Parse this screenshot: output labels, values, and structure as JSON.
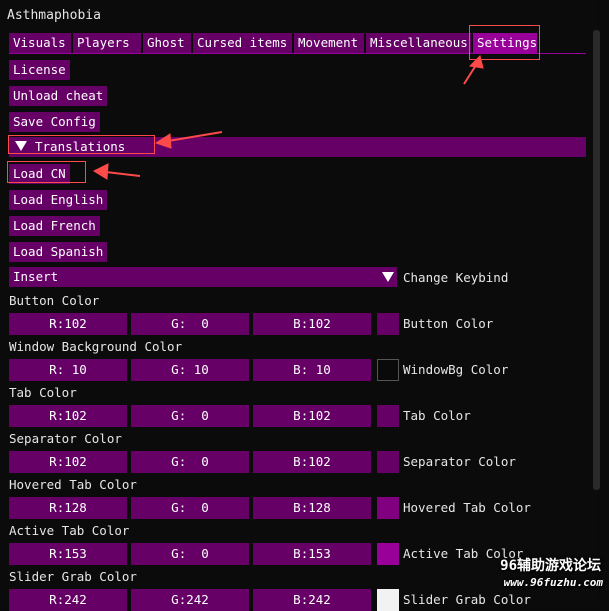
{
  "window": {
    "title": "Asthmaphobia"
  },
  "tabs": [
    {
      "label": "Visuals"
    },
    {
      "label": "Players"
    },
    {
      "label": "Ghost"
    },
    {
      "label": "Cursed items"
    },
    {
      "label": "Movement"
    },
    {
      "label": "Miscellaneous"
    },
    {
      "label": "Settings"
    }
  ],
  "actions": {
    "license": "License",
    "unload": "Unload cheat",
    "save": "Save Config"
  },
  "translations": {
    "header": "Translations",
    "load_cn": "Load CN",
    "load_english": "Load English",
    "load_french": "Load French",
    "load_spanish": "Load Spanish"
  },
  "keybind": {
    "value": "Insert",
    "label": "Change Keybind"
  },
  "colors": [
    {
      "title": "Button Color",
      "r": "R:102",
      "g": "G:  0",
      "b": "B:102",
      "label": "Button Color",
      "swatch": "#660066"
    },
    {
      "title": "Window Background Color",
      "r": "R: 10",
      "g": "G: 10",
      "b": "B: 10",
      "label": "WindowBg Color",
      "swatch": "#0a0a0a"
    },
    {
      "title": "Tab Color",
      "r": "R:102",
      "g": "G:  0",
      "b": "B:102",
      "label": "Tab Color",
      "swatch": "#660066"
    },
    {
      "title": "Separator Color",
      "r": "R:102",
      "g": "G:  0",
      "b": "B:102",
      "label": "Separator Color",
      "swatch": "#660066"
    },
    {
      "title": "Hovered Tab Color",
      "r": "R:128",
      "g": "G:  0",
      "b": "B:128",
      "label": "Hovered Tab Color",
      "swatch": "#800080"
    },
    {
      "title": "Active Tab Color",
      "r": "R:153",
      "g": "G:  0",
      "b": "B:153",
      "label": "Active Tab Color",
      "swatch": "#990099"
    },
    {
      "title": "Slider Grab Color",
      "r": "R:242",
      "g": "G:242",
      "b": "B:242",
      "label": "Slider Grab Color",
      "swatch": "#f2f2f2"
    }
  ],
  "watermark": {
    "line1": "96辅助游戏论坛",
    "line2": "www.96fuzhu.com"
  },
  "accent": {
    "annotation": "#ff4a4a",
    "button": "#660066",
    "active": "#990099"
  }
}
